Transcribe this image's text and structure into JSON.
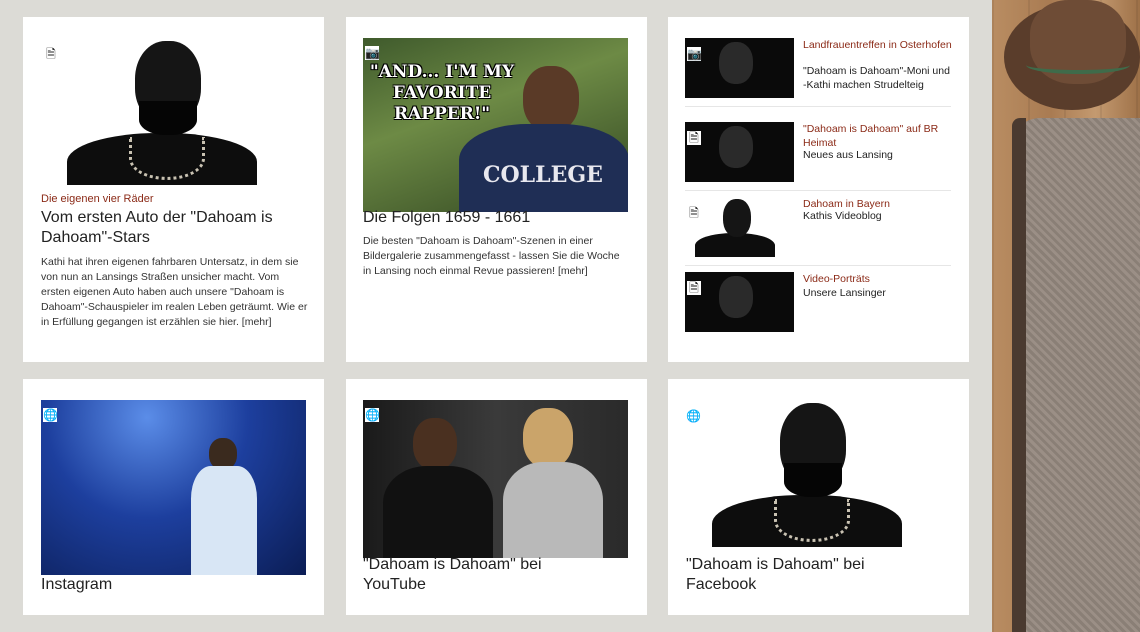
{
  "cards": {
    "auto": {
      "kicker": "Die eigenen vier Räder",
      "title": "Vom ersten Auto der \"Dahoam is Dahoam\"-Stars",
      "body": "Kathi hat ihren eigenen fahrbaren Untersatz, in dem sie von nun an Lansings Straßen unsicher macht. Vom ersten eigenen Auto haben auch unsere \"Dahoam is Dahoam\"-Schauspieler im realen Leben geträumt. Wie er in Erfüllung gegangen ist erzählen sie hier. [mehr]"
    },
    "folgen": {
      "meme_text": "\"AND... I'M MY FAVORITE RAPPER!\"",
      "shirt_text": "COLLEGE",
      "title": "Die Folgen 1659 - 1661",
      "body": "Die besten \"Dahoam is Dahoam\"-Szenen in einer Bildergalerie zusammengefasst - lassen Sie die Woche in Lansing noch einmal Revue passieren! [mehr]"
    },
    "side_list": [
      {
        "kicker": "Landfrauentreffen in Osterhofen",
        "desc": "\"Dahoam is Dahoam\"-Moni und -Kathi machen Strudelteig",
        "icon": "camera-icon"
      },
      {
        "kicker": "\"Dahoam is Dahoam\" auf BR Heimat",
        "desc": "Neues aus Lansing",
        "icon": "document-icon"
      },
      {
        "kicker": "Dahoam in Bayern",
        "desc": "Kathis Videoblog",
        "icon": "document-icon"
      },
      {
        "kicker": "Video-Porträts",
        "desc": "Unsere Lansinger",
        "icon": "document-icon"
      }
    ],
    "instagram": {
      "title": "Instagram"
    },
    "youtube": {
      "title": "\"Dahoam is Dahoam\" bei YouTube"
    },
    "facebook": {
      "title": "\"Dahoam is Dahoam\" bei Facebook"
    }
  },
  "icons": {
    "document": "🗎",
    "camera": "📷",
    "link": "🌐"
  },
  "colors": {
    "kicker": "#8b2a17",
    "page_bg": "#dcdbd6"
  }
}
